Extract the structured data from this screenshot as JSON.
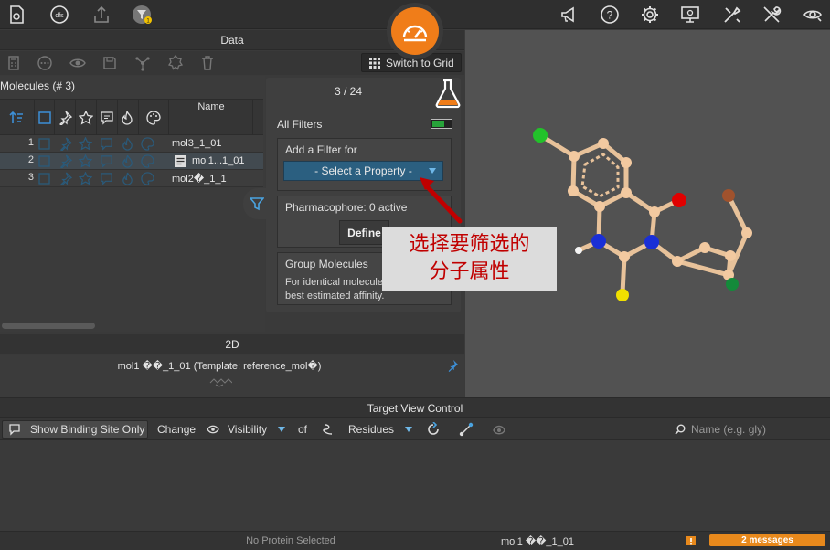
{
  "topbar": {
    "left_icons": [
      "file-icon",
      "dfs-icon",
      "export-icon",
      "filter-badge-icon"
    ],
    "filter_badge": "1",
    "right_icons": [
      "announce-icon",
      "help-icon",
      "settings-icon",
      "monitor-icon",
      "tools-icon",
      "wrench-icon",
      "view-icon"
    ]
  },
  "data_panel": {
    "header": "Data",
    "switch_grid": "Switch to Grid",
    "molecules_title": "Molecules (# 3)",
    "name_col": "Name",
    "rows": [
      {
        "num": "1",
        "name": "mol3_1_01"
      },
      {
        "num": "2",
        "name": "mol1...1_01"
      },
      {
        "num": "3",
        "name": "mol2�_1_1"
      }
    ]
  },
  "filter_panel": {
    "count": "3 / 24",
    "all_filters": "All Filters",
    "add_filter_label": "Add a Filter for",
    "select_property": "- Select a Property -",
    "pharmacophore": "Pharmacophore: 0 active",
    "define": "Define",
    "group_title": "Group Molecules",
    "group_desc": "For identical molecules, show only best estimated affinity."
  },
  "annotation": {
    "line1": "选择要筛选的",
    "line2": "分子属性"
  },
  "twod": {
    "header": "2D",
    "caption": "mol1 ��_1_01 (Template: reference_mol�)"
  },
  "tvc": {
    "header": "Target View Control",
    "show_binding": "Show Binding Site Only",
    "change": "Change",
    "visibility": "Visibility",
    "of": "of",
    "residues": "Residues",
    "search_placeholder": "Name (e.g. gly)"
  },
  "status": {
    "protein": "No Protein Selected",
    "molecule": "mol1 ��_1_01",
    "messages": "2 messages"
  },
  "colors": {
    "accent_orange": "#f07d19",
    "select_blue": "#2b5f80",
    "carbon": "#f2c9a0",
    "nitrogen": "#1a2fd6",
    "oxygen": "#e00000",
    "chlorine": "#22c22a",
    "sulfur": "#f0e000",
    "bromine": "#a0522d"
  }
}
